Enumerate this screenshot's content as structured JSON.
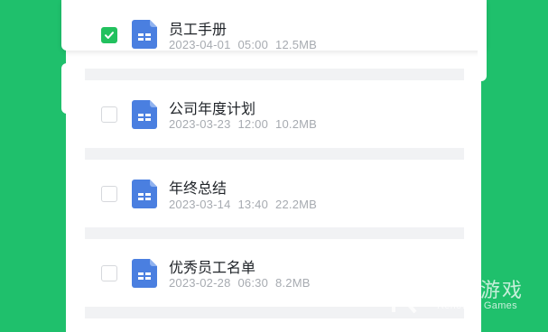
{
  "files": [
    {
      "name": "员工手册",
      "date": "2023-04-01",
      "time": "05:00",
      "size": "12.5MB",
      "checked": true
    },
    {
      "name": "公司年度计划",
      "date": "2023-03-23",
      "time": "12:00",
      "size": "10.2MB",
      "checked": false
    },
    {
      "name": "年终总结",
      "date": "2023-03-14",
      "time": "13:40",
      "size": "22.2MB",
      "checked": false
    },
    {
      "name": "优秀员工名单",
      "date": "2023-02-28",
      "time": "06:30",
      "size": "8.2MB",
      "checked": false
    }
  ],
  "watermark": {
    "title": "仍玩游戏",
    "subtitle": "Renowan Games"
  },
  "colors": {
    "background": "#1fc06c",
    "checkbox_checked": "#22c15e",
    "file_icon": "#4a7fe0"
  },
  "icons": {
    "file": "document-icon",
    "check": "checkmark-icon",
    "logo": "renowan-logo-icon"
  }
}
